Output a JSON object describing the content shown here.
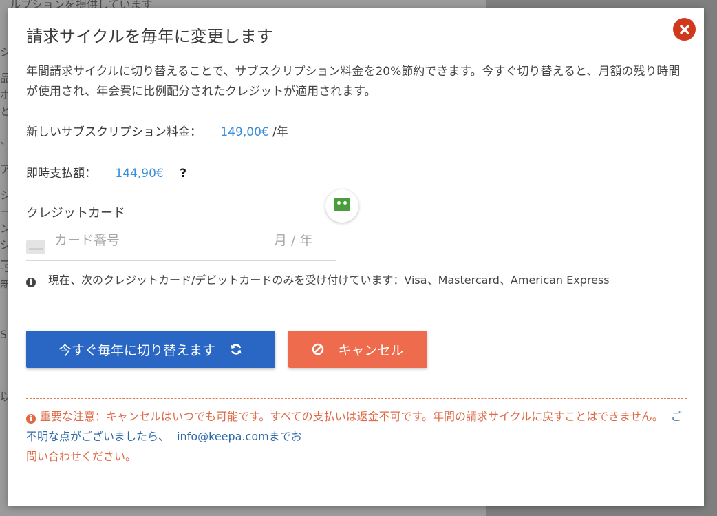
{
  "background": {
    "top_text": "ルプションを提供しています",
    "edge_chars": [
      "シ",
      "品",
      "ボ",
      "と",
      "、",
      "ア",
      "シ",
      "ー",
      "ン",
      "シ",
      "ー",
      "-5",
      "新",
      "S",
      "以"
    ]
  },
  "modal": {
    "title": "請求サイクルを毎年に変更します",
    "description": "年間請求サイクルに切り替えることで、サブスクリプション料金を20%節約できます。今すぐ切り替えると、月額の残り時間が使用され、年会費に比例配分されたクレジットが適用されます。",
    "price": {
      "label": "新しいサブスクリプション料金：",
      "amount": "149,00€",
      "period": "/年"
    },
    "due": {
      "label": "即時支払額：",
      "amount": "144,90€",
      "help": "?"
    },
    "credit_card": {
      "label": "クレジットカード",
      "number_placeholder": "カード番号",
      "expiry_placeholder": "月 / 年"
    },
    "accepted_cards": "現在、次のクレジットカード/デビットカードのみを受け付けています：Visa、Mastercard、American Express",
    "buttons": {
      "switch": "今すぐ毎年に切り替えます",
      "cancel": "キャンセル"
    },
    "note": {
      "text": "重要な注意：キャンセルはいつでも可能です。すべての支払いは返金不可です。年間の請求サイクルに戻すことはできません。",
      "contact_prefix": "ご不明な点がございましたら、",
      "email": "info@keepa.com",
      "contact_suffix": "までお",
      "contact_end": "問い合わせください。"
    }
  },
  "colors": {
    "primary_button": "#2a67c5",
    "cancel_button": "#ee6b4d",
    "close_button": "#d0391c",
    "price_blue": "#3a8fd9",
    "note_orange": "#e06a45"
  },
  "icons": {
    "close": "close-icon",
    "refresh": "refresh-icon",
    "ban": "ban-icon",
    "info": "info-icon",
    "card": "credit-card-icon",
    "robo": "roboform-icon"
  }
}
